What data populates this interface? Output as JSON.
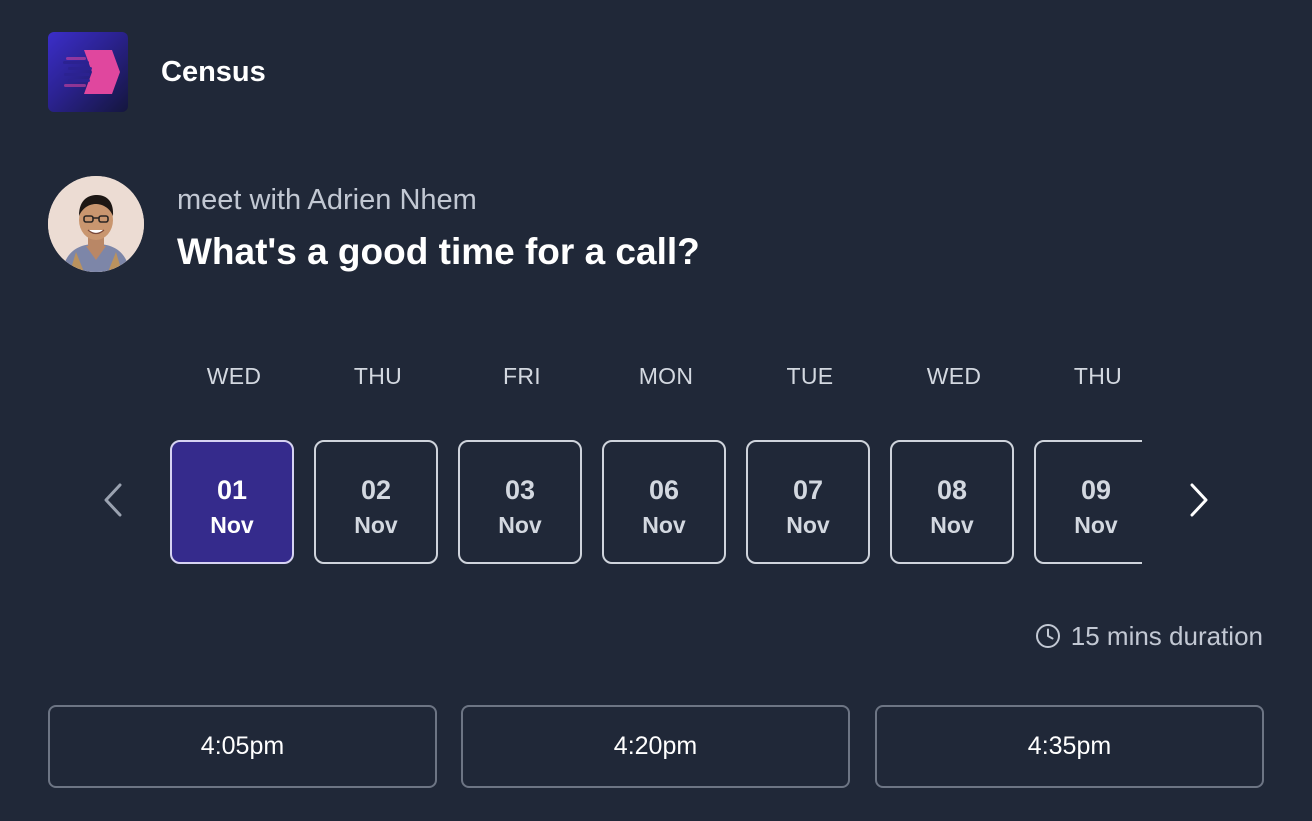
{
  "brand": {
    "name": "Census",
    "logo_icon": "census-chevron-logo",
    "logo_colors": [
      "#3b2ec9",
      "#e0479e"
    ]
  },
  "host": {
    "meet_with": "meet with Adrien Nhem",
    "headline": "What's a good time for a call?",
    "avatar_icon": "host-avatar"
  },
  "dates": [
    {
      "weekday": "WED",
      "day": "01",
      "month": "Nov",
      "selected": true
    },
    {
      "weekday": "THU",
      "day": "02",
      "month": "Nov",
      "selected": false
    },
    {
      "weekday": "FRI",
      "day": "03",
      "month": "Nov",
      "selected": false
    },
    {
      "weekday": "MON",
      "day": "06",
      "month": "Nov",
      "selected": false
    },
    {
      "weekday": "TUE",
      "day": "07",
      "month": "Nov",
      "selected": false
    },
    {
      "weekday": "WED",
      "day": "08",
      "month": "Nov",
      "selected": false
    },
    {
      "weekday": "THU",
      "day": "09",
      "month": "Nov",
      "selected": false
    }
  ],
  "navigation": {
    "prev_icon": "chevron-left-icon",
    "next_icon": "chevron-right-icon"
  },
  "duration": {
    "icon": "clock-icon",
    "label": "15 mins duration"
  },
  "time_slots": [
    "4:05pm",
    "4:20pm",
    "4:35pm"
  ],
  "colors": {
    "background": "#202838",
    "selected_date": "#352b8c",
    "border": "#cfd4dc",
    "muted_text": "#c2c8d3"
  }
}
